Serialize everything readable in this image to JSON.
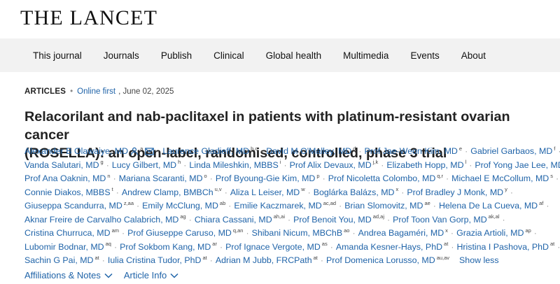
{
  "brand": {
    "name": "THE LANCET"
  },
  "nav": {
    "items": [
      "This journal",
      "Journals",
      "Publish",
      "Clinical",
      "Global health",
      "Multimedia",
      "Events",
      "About"
    ]
  },
  "meta": {
    "type": "ARTICLES",
    "status": "Online first",
    "date": ", June 02, 2025"
  },
  "article": {
    "title_line1": "Relacorilant and nab-paclitaxel in patients with platinum-resistant ovarian cancer",
    "title_line2": "(ROSELLA): an open-label, randomised, controlled, phase 3 trial"
  },
  "authors": [
    {
      "name": "Alexander B Olawaiye, MD",
      "sup": "a"
    },
    {
      "name": "Laurence Gladieff, MD",
      "sup": "b,c"
    },
    {
      "name": "David M O'Malley, MD",
      "sup": "d"
    },
    {
      "name": "Prof Jae-Weon Kim, MD",
      "sup": "e"
    },
    {
      "name": "Gabriel Garbaos, MD",
      "sup": "f"
    },
    {
      "name": "Vanda Salutari, MD",
      "sup": "g"
    },
    {
      "name": "Lucy Gilbert, MD",
      "sup": "h"
    },
    {
      "name": "Linda Mileshkin, MBBS",
      "sup": "i"
    },
    {
      "name": "Prof Alix Devaux, MD",
      "sup": "j,k"
    },
    {
      "name": "Elizabeth Hopp, MD",
      "sup": "l"
    },
    {
      "name": "Prof Yong Jae Lee, MD",
      "sup": "m"
    },
    {
      "name": "Prof Ana Oaknin, MD",
      "sup": "n"
    },
    {
      "name": "Mariana Scaranti, MD",
      "sup": "o"
    },
    {
      "name": "Prof Byoung-Gie Kim, MD",
      "sup": "p"
    },
    {
      "name": "Prof Nicoletta Colombo, MD",
      "sup": "q,r"
    },
    {
      "name": "Michael E McCollum, MD",
      "sup": "s"
    },
    {
      "name": "Connie Diakos, MBBS",
      "sup": "t"
    },
    {
      "name": "Andrew Clamp, BMBCh",
      "sup": "u,v"
    },
    {
      "name": "Aliza L Leiser, MD",
      "sup": "w"
    },
    {
      "name": "Boglárka Balázs, MD",
      "sup": "x"
    },
    {
      "name": "Prof Bradley J Monk, MD",
      "sup": "y"
    },
    {
      "name": "Giuseppa Scandurra, MD",
      "sup": "z,aa"
    },
    {
      "name": "Emily McClung, MD",
      "sup": "ab"
    },
    {
      "name": "Emilie Kaczmarek, MD",
      "sup": "ac,ad"
    },
    {
      "name": "Brian Slomovitz, MD",
      "sup": "ae"
    },
    {
      "name": "Helena De La Cueva, MD",
      "sup": "af"
    },
    {
      "name": "Aknar Freire de Carvalho Calabrich, MD",
      "sup": "ag"
    },
    {
      "name": "Chiara Cassani, MD",
      "sup": "ah,ai"
    },
    {
      "name": "Prof Benoit You, MD",
      "sup": "ad,aj"
    },
    {
      "name": "Prof Toon Van Gorp, MD",
      "sup": "ak,al"
    },
    {
      "name": "Cristina Churruca, MD",
      "sup": "am"
    },
    {
      "name": "Prof Giuseppe Caruso, MD",
      "sup": "q,an"
    },
    {
      "name": "Shibani Nicum, MBChB",
      "sup": "ao"
    },
    {
      "name": "Andrea Bagaméri, MD",
      "sup": "x"
    },
    {
      "name": "Grazia Artioli, MD",
      "sup": "ap"
    },
    {
      "name": "Lubomir Bodnar, MD",
      "sup": "aq"
    },
    {
      "name": "Prof Sokbom Kang, MD",
      "sup": "ar"
    },
    {
      "name": "Prof Ignace Vergote, MD",
      "sup": "as"
    },
    {
      "name": "Amanda Kesner-Hays, PhD",
      "sup": "at"
    },
    {
      "name": "Hristina I Pashova, PhD",
      "sup": "at"
    },
    {
      "name": "Sachin G Pai, MD",
      "sup": "at"
    },
    {
      "name": "Iulia Cristina Tudor, PhD",
      "sup": "at"
    },
    {
      "name": "Adrian M Jubb, FRCPath",
      "sup": "at"
    },
    {
      "name": "Prof Domenica Lorusso, MD",
      "sup": "au,av"
    }
  ],
  "show_less_label": "Show less",
  "bottom_links": {
    "affiliations": "Affiliations & Notes",
    "article_info": "Article Info"
  }
}
